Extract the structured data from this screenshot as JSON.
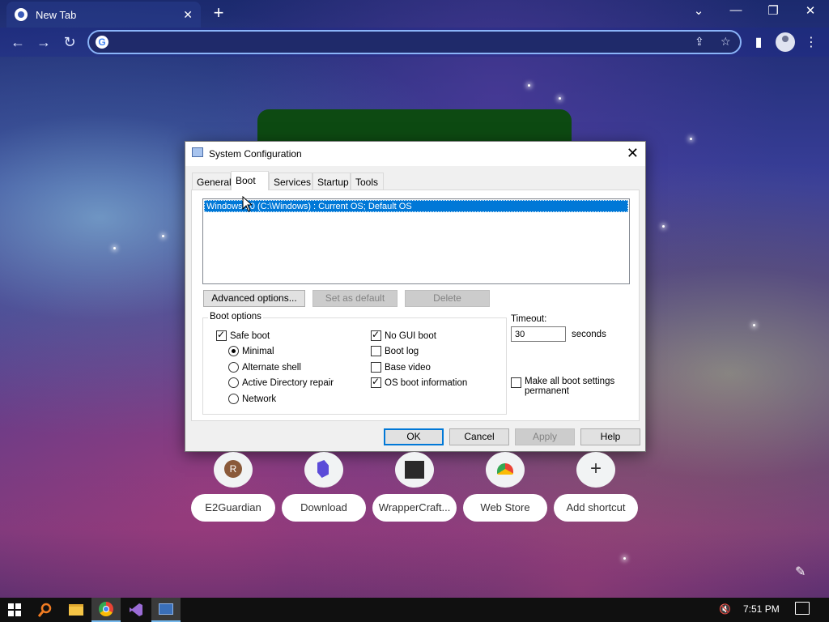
{
  "browser": {
    "tab_title": "New Tab",
    "tab_close": "✕",
    "new_tab": "+",
    "window_controls": {
      "list": "⌄",
      "minimize": "—",
      "maximize": "❐",
      "close": "✕"
    },
    "omnibox_value": "",
    "nav": {
      "back": "←",
      "forward": "→",
      "reload": "↻"
    },
    "icons": {
      "share": "⇪",
      "star": "☆",
      "sidepanel": "▮",
      "menu": "⋮"
    }
  },
  "dialog": {
    "title": "System Configuration",
    "close": "✕",
    "tabs": [
      "General",
      "Boot",
      "Services",
      "Startup",
      "Tools"
    ],
    "active_tab": "Boot",
    "os_entry": "Windows 10 (C:\\Windows) : Current OS; Default OS",
    "buttons": {
      "advanced": "Advanced options...",
      "set_default": "Set as default",
      "delete": "Delete",
      "ok": "OK",
      "cancel": "Cancel",
      "apply": "Apply",
      "help": "Help"
    },
    "boot_options_label": "Boot options",
    "safe_boot": {
      "label": "Safe boot",
      "checked": true
    },
    "radios": [
      {
        "label": "Minimal",
        "selected": true
      },
      {
        "label": "Alternate shell",
        "selected": false
      },
      {
        "label": "Active Directory repair",
        "selected": false
      },
      {
        "label": "Network",
        "selected": false
      }
    ],
    "right_checks": [
      {
        "label": "No GUI boot",
        "checked": true
      },
      {
        "label": "Boot log",
        "checked": false
      },
      {
        "label": "Base video",
        "checked": false
      },
      {
        "label": "OS boot information",
        "checked": true
      }
    ],
    "timeout_label": "Timeout:",
    "timeout_value": "30",
    "seconds_label": "seconds",
    "permanent_line1": "Make all boot settings",
    "permanent_line2": "permanent"
  },
  "shortcuts": [
    {
      "label": "E2Guardian",
      "icon": "R"
    },
    {
      "label": "Download",
      "icon": ""
    },
    {
      "label": "WrapperCraft...",
      "icon": ""
    },
    {
      "label": "Web Store",
      "icon": ""
    },
    {
      "label": "Add shortcut",
      "icon": "+"
    }
  ],
  "taskbar": {
    "time": "7:51 PM",
    "icons": [
      "windows-start-icon",
      "search-icon",
      "file-explorer-icon",
      "chrome-icon",
      "visual-studio-icon",
      "system-config-icon"
    ]
  }
}
